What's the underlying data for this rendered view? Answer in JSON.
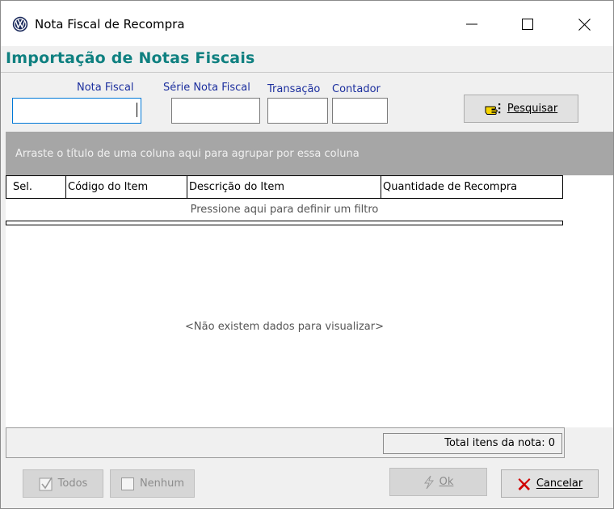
{
  "window": {
    "title": "Nota Fiscal de Recompra",
    "app_icon": "vw-logo-icon"
  },
  "header": {
    "title": "Importação de Notas Fiscais"
  },
  "fields": {
    "nota_fiscal_label": "Nota Fiscal",
    "nota_fiscal_value": "",
    "serie_label": "Série Nota Fiscal",
    "serie_value": "",
    "transacao_label": "Transação",
    "transacao_value": "",
    "contador_label": "Contador",
    "contador_value": ""
  },
  "buttons": {
    "pesquisar_label": "Pesquisar",
    "pesquisar_icon": "pointing-hand-icon",
    "todos_label": "Todos",
    "nenhum_label": "Nenhum",
    "ok_label": "Ok",
    "cancelar_label": "Cancelar"
  },
  "grid": {
    "group_hint": "Arraste o título de uma coluna aqui para agrupar por essa coluna",
    "columns": [
      "Sel.",
      "Código do Item",
      "Descrição do Item",
      "Quantidade de Recompra"
    ],
    "filter_hint": "Pressione aqui para definir um filtro",
    "empty_message": "<Não existem dados para visualizar>"
  },
  "summary": {
    "total_label": "Total itens da nota: 0"
  },
  "colors": {
    "accent_teal": "#0f8080",
    "label_blue": "#1c2f9e",
    "group_band_gray": "#a6a6a6",
    "cancel_red": "#d00000"
  }
}
